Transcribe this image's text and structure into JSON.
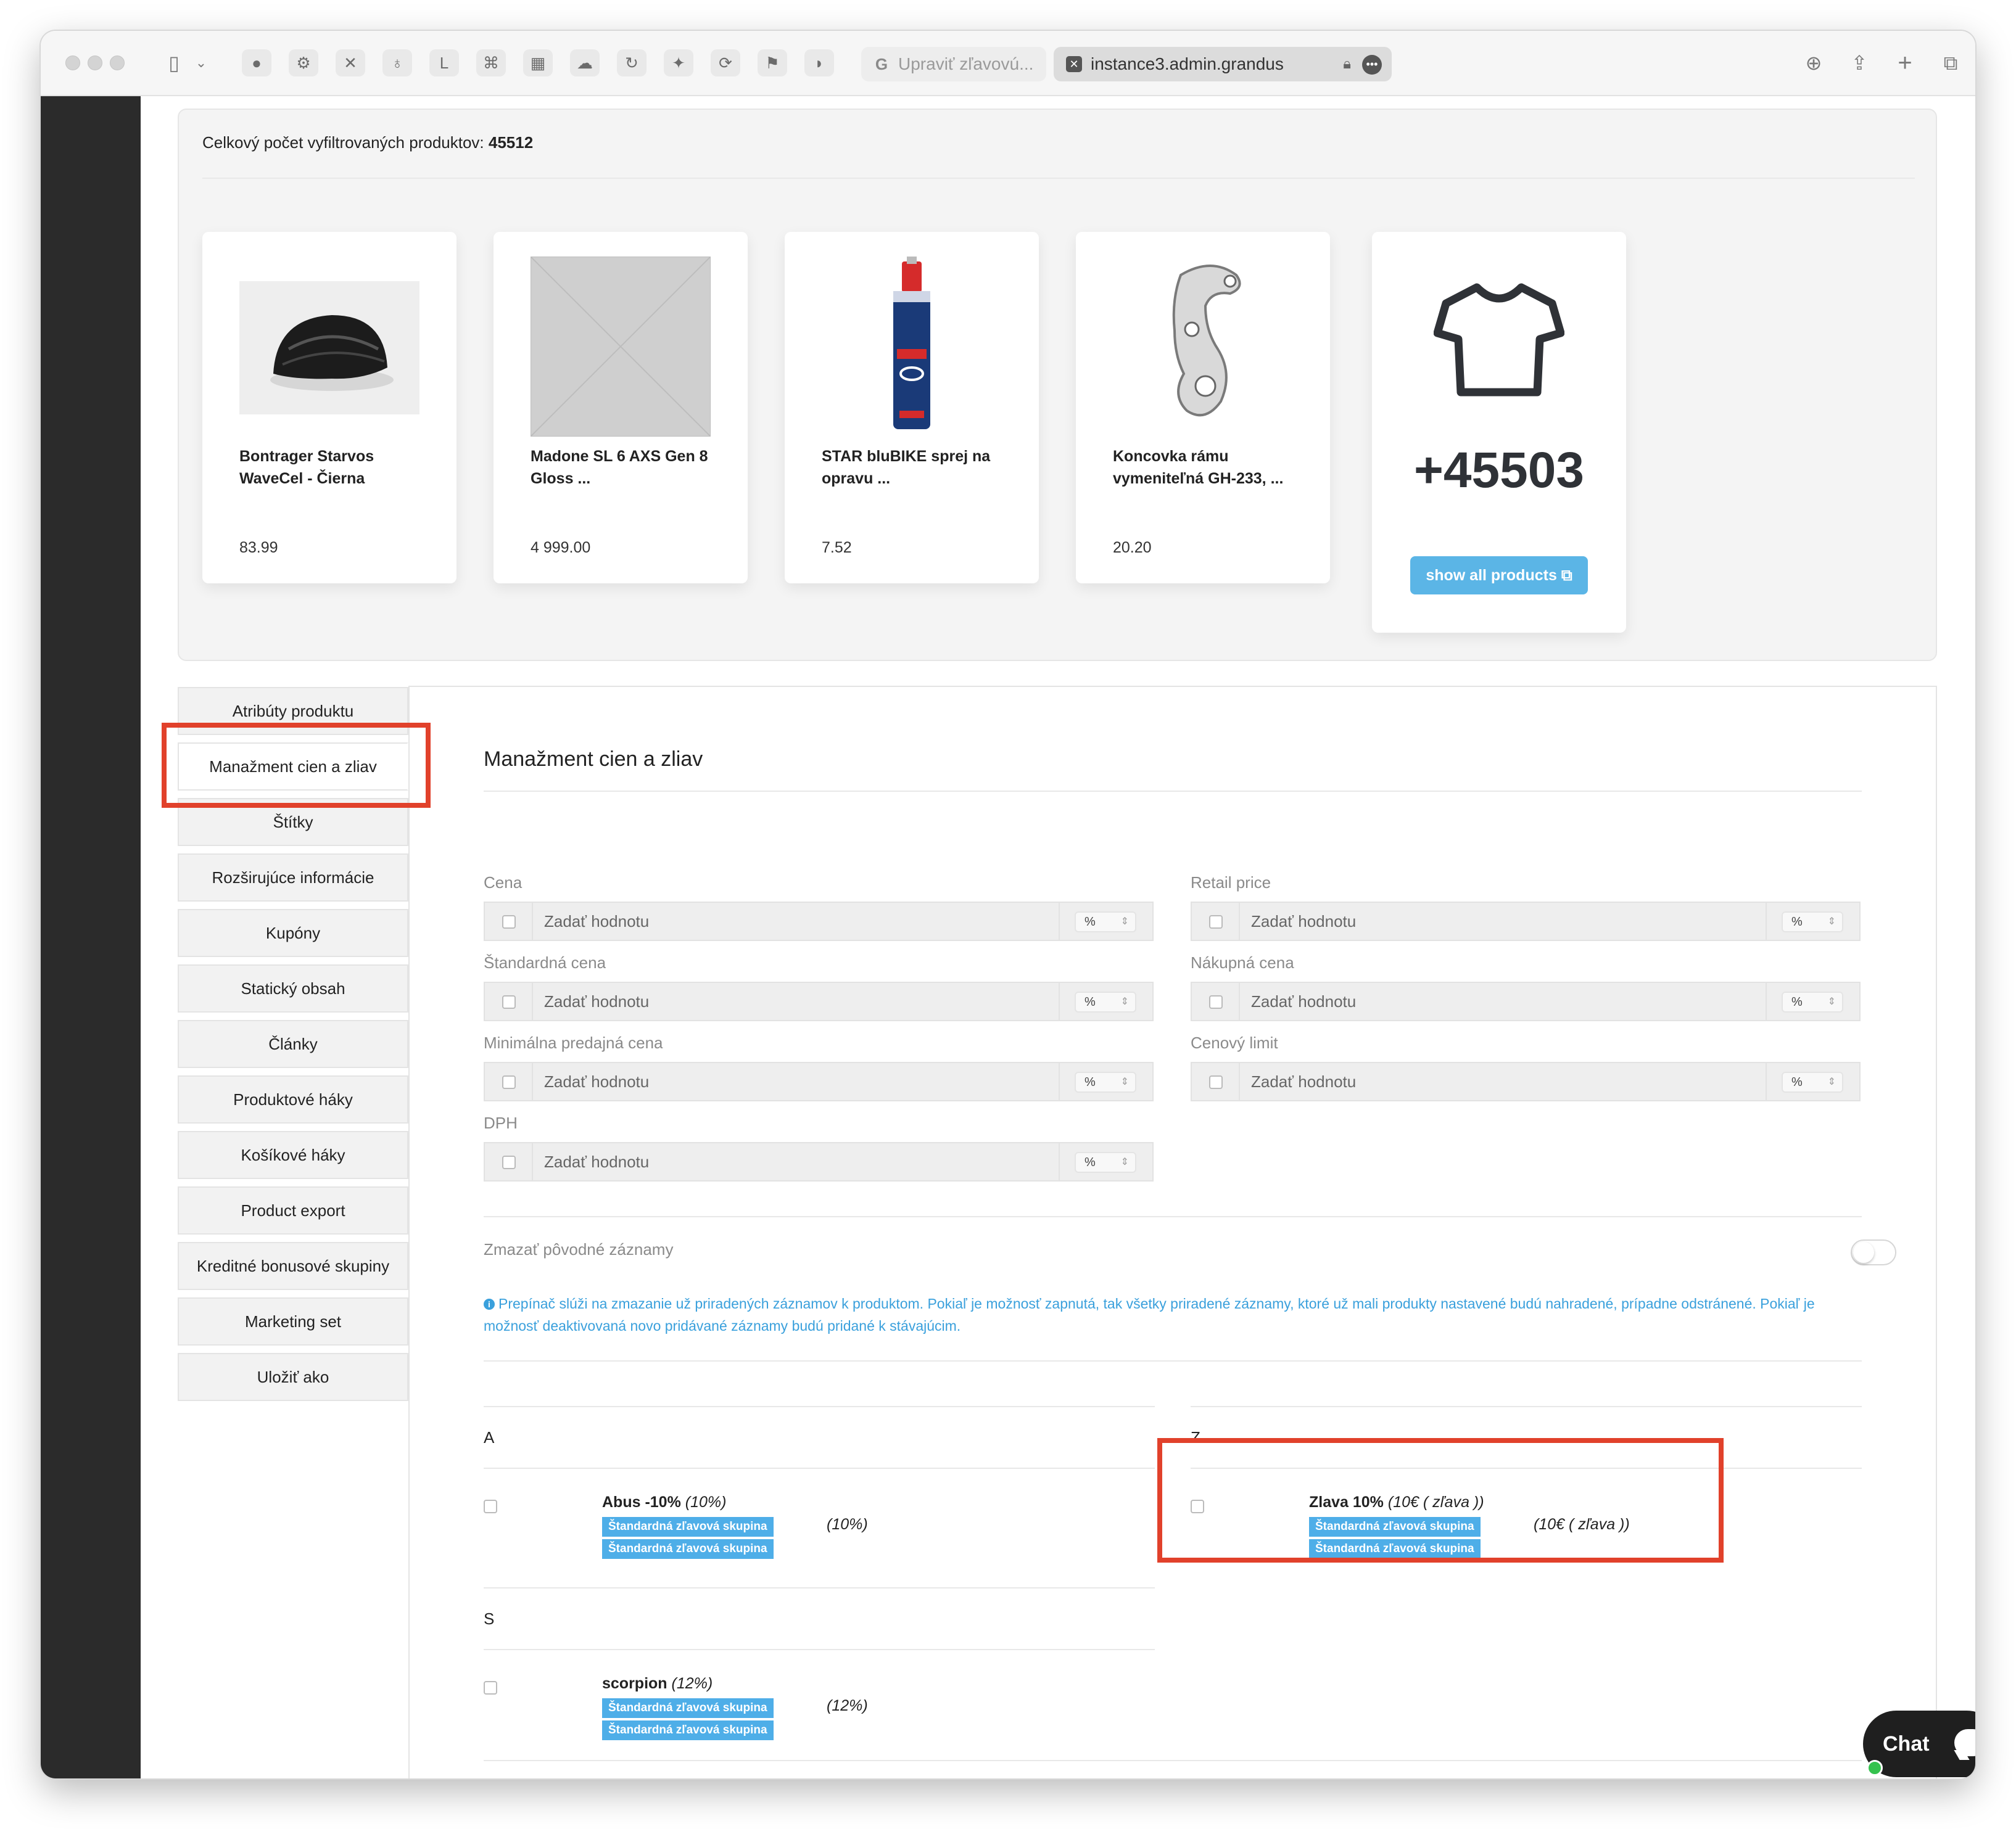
{
  "browser": {
    "tabs": [
      {
        "label": "Upraviť zľavovú..."
      },
      {
        "label": "instance3.admin.grandus"
      }
    ]
  },
  "panel": {
    "count_label": "Celkový počet vyfiltrovaných produktov:",
    "count_value": "45512",
    "products": [
      {
        "name": "Bontrager Starvos WaveCel - Čierna",
        "price": "83.99"
      },
      {
        "name": "Madone SL 6 AXS Gen 8 Gloss ...",
        "price": "4 999.00"
      },
      {
        "name": "STAR bluBIKE sprej na opravu ...",
        "price": "7.52"
      },
      {
        "name": "Koncovka rámu vymeniteľná GH-233, ...",
        "price": "20.20"
      }
    ],
    "more_count": "+45503",
    "show_all_label": "show all products"
  },
  "side_tabs": [
    {
      "label": "Atribúty produktu"
    },
    {
      "label": "Manažment cien a zliav"
    },
    {
      "label": "Štítky"
    },
    {
      "label": "Rozširujúce informácie"
    },
    {
      "label": "Kupóny"
    },
    {
      "label": "Statický obsah"
    },
    {
      "label": "Články"
    },
    {
      "label": "Produktové háky"
    },
    {
      "label": "Košíkové háky"
    },
    {
      "label": "Product export"
    },
    {
      "label": "Kreditné bonusové skupiny"
    },
    {
      "label": "Marketing set"
    },
    {
      "label": "Uložiť ako"
    }
  ],
  "main": {
    "title": "Manažment cien a zliav",
    "placeholder": "Zadať hodnotu",
    "unit": "%",
    "fields": [
      {
        "label": "Cena"
      },
      {
        "label": "Retail price"
      },
      {
        "label": "Štandardná cena"
      },
      {
        "label": "Nákupná cena"
      },
      {
        "label": "Minimálna predajná cena"
      },
      {
        "label": "Cenový limit"
      },
      {
        "label": "DPH"
      }
    ],
    "toggle_label": "Zmazať pôvodné záznamy",
    "info_text": "Prepínač slúži na zmazanie už priradených záznamov k produktom. Pokiaľ je možnosť zapnutá, tak všetky priradené záznamy, ktoré už mali produkty nastavené budú nahradené, prípadne odstránené. Pokiaľ je možnosť deaktivovaná novo pridávané záznamy budú pridané k stávajúcim.",
    "groups": [
      {
        "letter": "A",
        "name": "Abus -10%",
        "value": "(10%)",
        "badge": "Štandardná zľavová skupina",
        "badge_value": "(10%)"
      },
      {
        "letter": "Z",
        "name": "Zlava 10%",
        "value": "(10€ ( zľava ))",
        "badge": "Štandardná zľavová skupina",
        "badge_value": "(10€ ( zľava ))"
      },
      {
        "letter": "S",
        "name": "scorpion",
        "value": "(12%)",
        "badge": "Štandardná zľavová skupina",
        "badge_value": "(12%)"
      }
    ]
  },
  "chat": {
    "label": "Chat"
  }
}
